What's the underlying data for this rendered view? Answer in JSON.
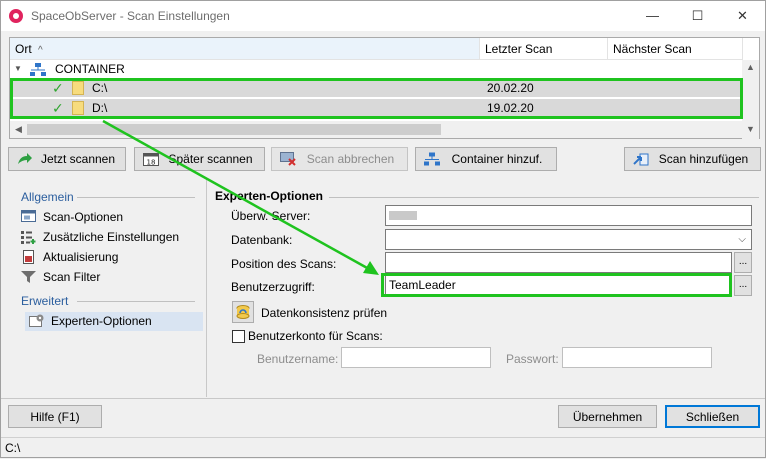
{
  "window": {
    "title": "SpaceObServer - Scan Einstellungen",
    "min": "—",
    "max": "☐",
    "close": "✕"
  },
  "tree": {
    "columns": [
      "Ort",
      "Letzter Scan",
      "Nächster Scan"
    ],
    "sort_indicator": "^",
    "root": {
      "label": "CONTAINER",
      "icon": "network-icon"
    },
    "rows": [
      {
        "label": "C:\\",
        "last_scan": "20.02.20",
        "next_scan": ""
      },
      {
        "label": "D:\\",
        "last_scan": "19.02.20",
        "next_scan": ""
      }
    ]
  },
  "toolbar": {
    "scan_now": "Jetzt scannen",
    "scan_later": "Später scannen",
    "cancel_scan": "Scan abbrechen",
    "add_container": "Container hinzuf.",
    "add_scan": "Scan hinzufügen",
    "calendar_day": "18"
  },
  "sidebar": {
    "group1": "Allgemein",
    "items1": [
      "Scan-Optionen",
      "Zusätzliche Einstellungen",
      "Aktualisierung",
      "Scan Filter"
    ],
    "group2": "Erweitert",
    "items2": [
      "Experten-Optionen"
    ]
  },
  "expert": {
    "header": "Experten-Optionen",
    "server_label": "Überw. Server:",
    "server_value": "",
    "db_label": "Datenbank:",
    "db_value": "",
    "position_label": "Position des Scans:",
    "position_value": "",
    "user_access_label": "Benutzerzugriff:",
    "user_access_value": "TeamLeader",
    "check_db": "Datenkonsistenz prüfen",
    "account_checkbox": "Benutzerkonto für Scans:",
    "username_label": "Benutzername:",
    "password_label": "Passwort:",
    "browse": "..."
  },
  "footer": {
    "help": "Hilfe (F1)",
    "apply": "Übernehmen",
    "close": "Schließen"
  },
  "status": {
    "path": "C:\\"
  },
  "colors": {
    "highlight": "#1fc31f",
    "accent": "#0078d7",
    "group": "#2b5e9e"
  }
}
